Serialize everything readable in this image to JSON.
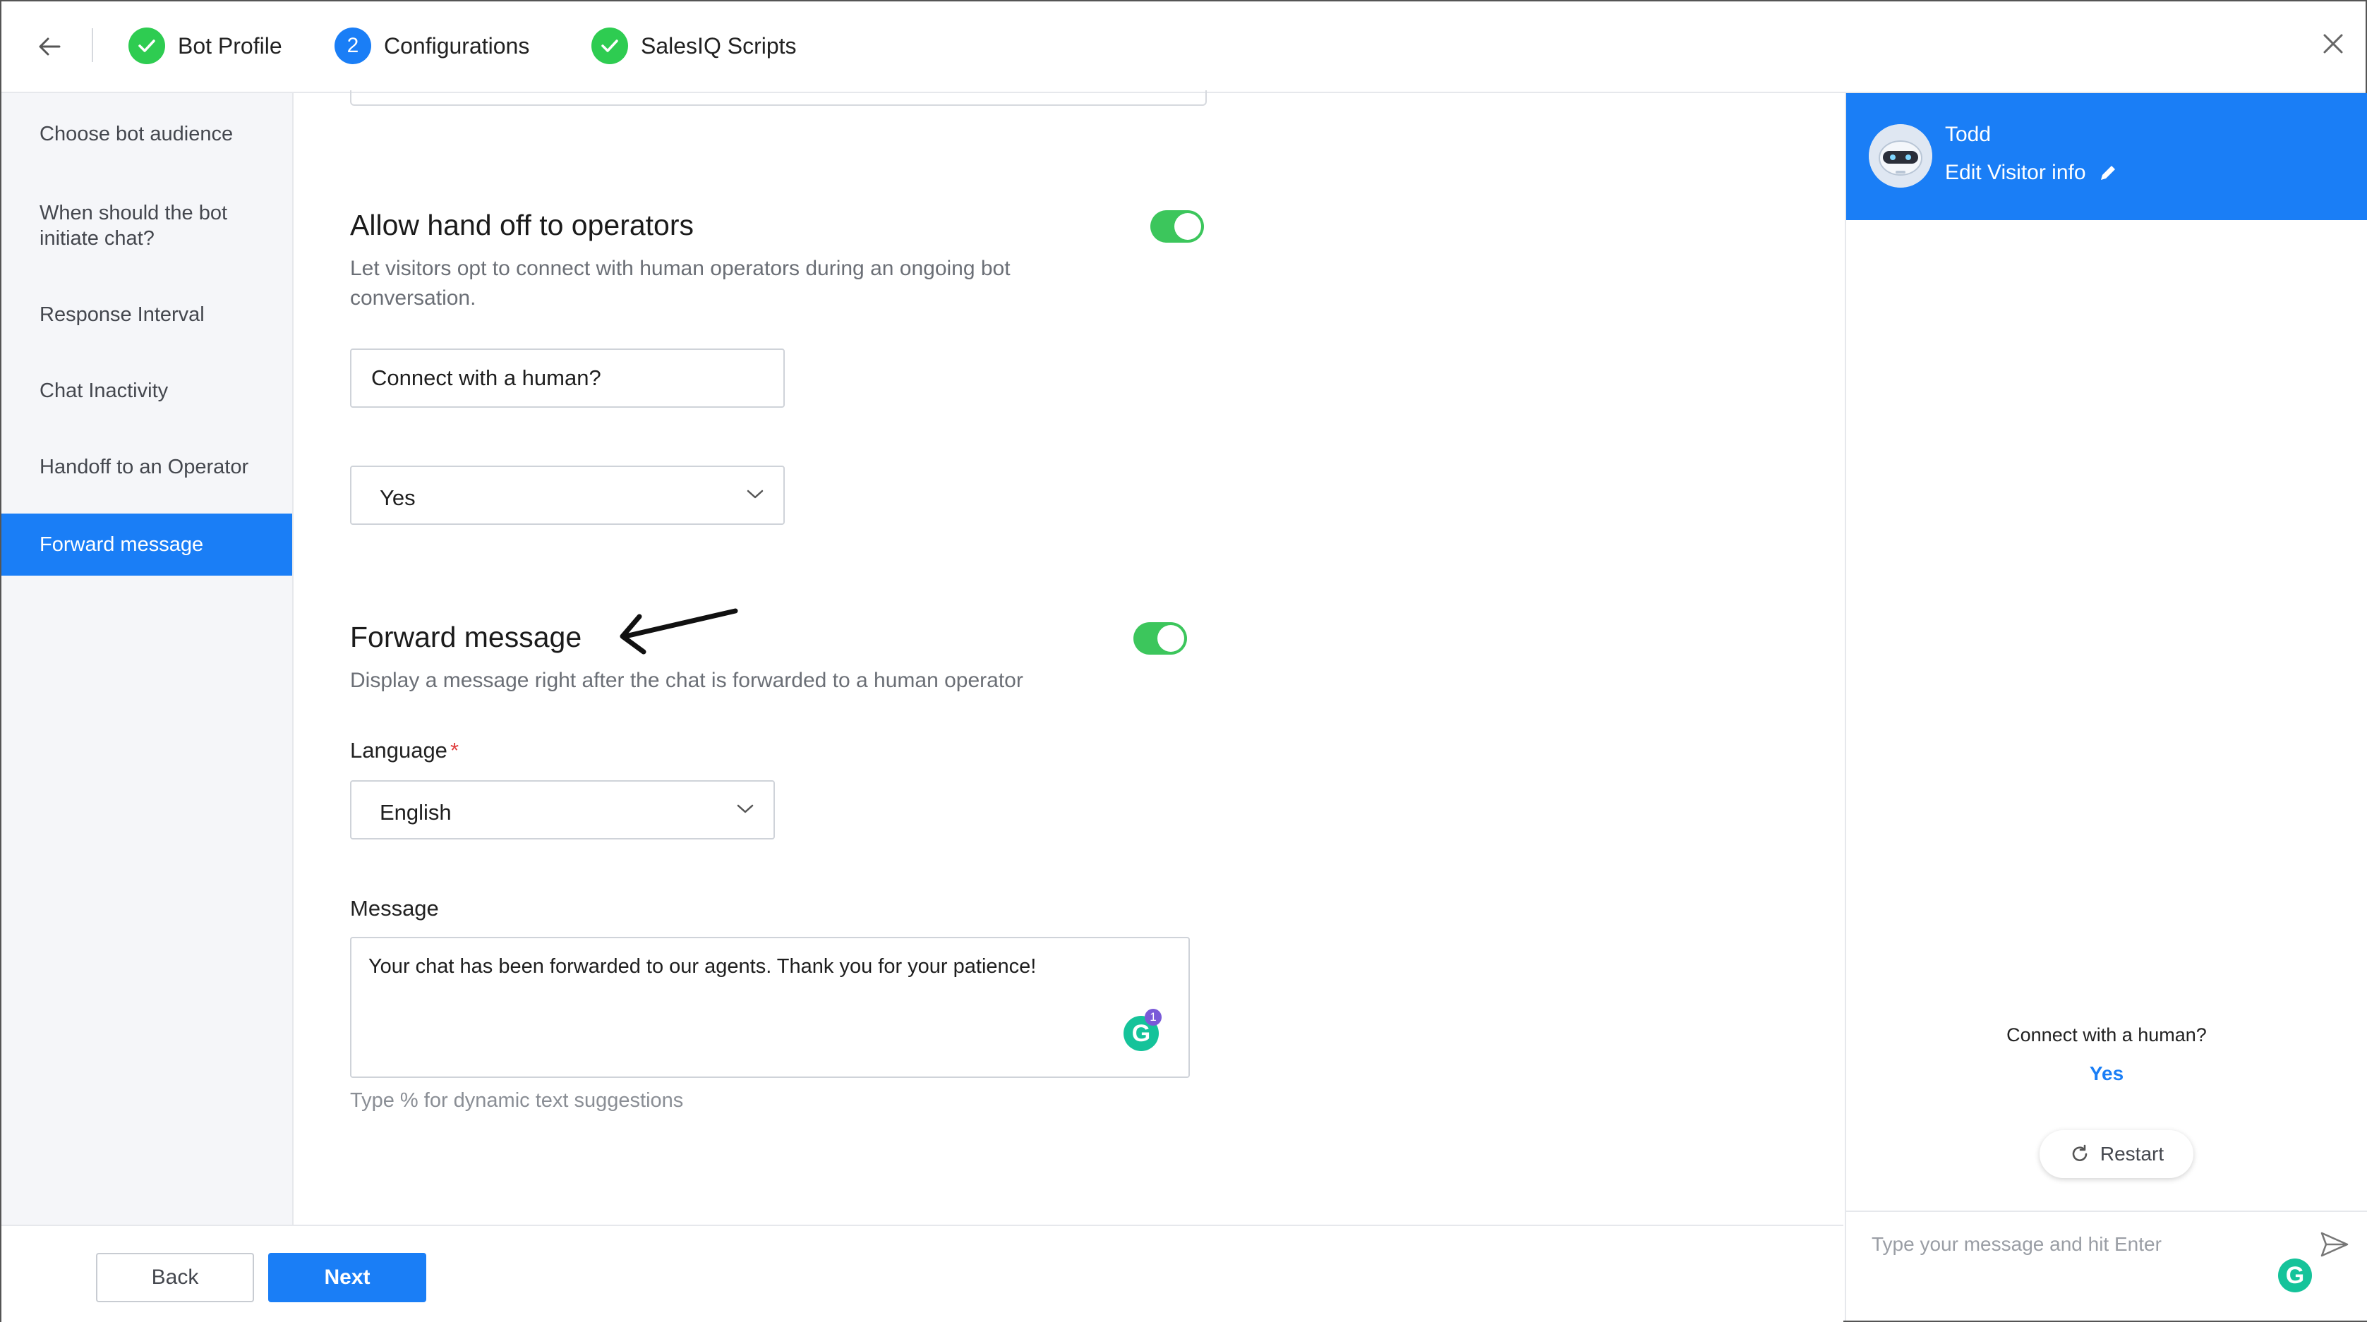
{
  "stepper": {
    "steps": [
      {
        "label": "Bot Profile",
        "state": "done"
      },
      {
        "label": "Configurations",
        "state": "current",
        "number": "2"
      },
      {
        "label": "SalesIQ Scripts",
        "state": "done"
      }
    ]
  },
  "sidebar": {
    "items": [
      {
        "label": "Choose bot audience"
      },
      {
        "label": "When should the bot initiate chat?"
      },
      {
        "label": "Response Interval"
      },
      {
        "label": "Chat Inactivity"
      },
      {
        "label": "Handoff to an Operator"
      },
      {
        "label": "Forward message",
        "active": true
      }
    ]
  },
  "handoff": {
    "title": "Allow hand off to operators",
    "description": "Let visitors opt to connect with human operators during an ongoing bot conversation.",
    "enabled": true,
    "question_value": "Connect with a human?",
    "option_value": "Yes"
  },
  "forward": {
    "title": "Forward message",
    "description": "Display a message right after the chat is forwarded to a human operator",
    "enabled": true,
    "language_label": "Language",
    "required_mark": "*",
    "language_value": "English",
    "message_label": "Message",
    "message_value": "Your chat has been forwarded to our agents. Thank you for your patience!",
    "hint": "Type % for dynamic text suggestions",
    "grammarly_count": "1"
  },
  "footer": {
    "back_label": "Back",
    "next_label": "Next"
  },
  "preview": {
    "bot_name": "Todd",
    "edit_label": "Edit Visitor info",
    "question": "Connect with a human?",
    "answer": "Yes",
    "restart_label": "Restart",
    "input_placeholder": "Type your message and hit Enter"
  },
  "colors": {
    "accent": "#1a7ef6",
    "success": "#2ecc51",
    "toggle_on": "#3cc65c"
  }
}
